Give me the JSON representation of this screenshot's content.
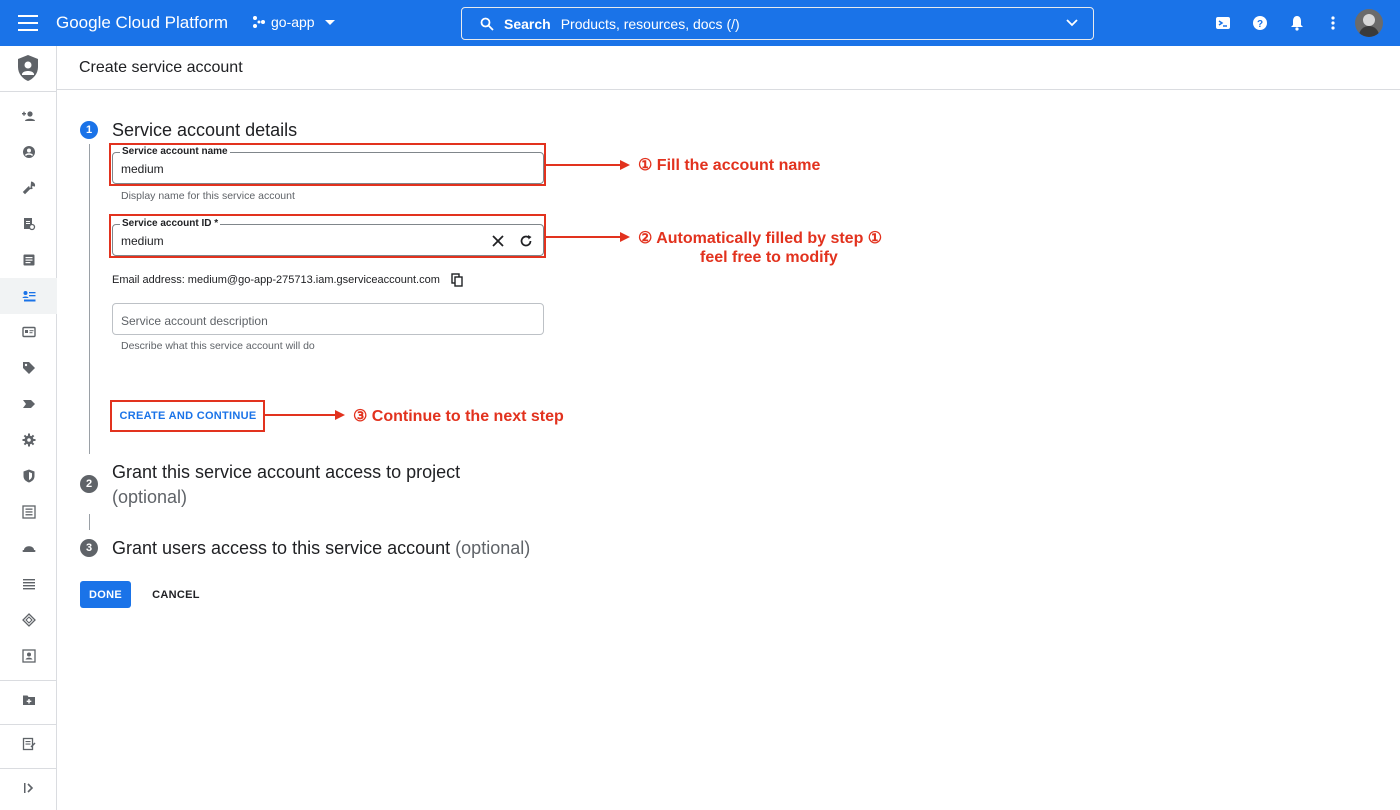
{
  "topbar": {
    "app_title": "Google Cloud Platform",
    "project_name": "go-app",
    "search_label": "Search",
    "search_hint": "Products, resources, docs (/)"
  },
  "header": {
    "title": "Create service account"
  },
  "steps": [
    {
      "number": "1",
      "title": "Service account details",
      "optional": ""
    },
    {
      "number": "2",
      "title": "Grant this service account access to project",
      "optional": "(optional)"
    },
    {
      "number": "3",
      "title": "Grant users access to this service account",
      "optional": "(optional)"
    }
  ],
  "form": {
    "name_label": "Service account name",
    "name_value": "medium",
    "name_hint": "Display name for this service account",
    "id_label": "Service account ID *",
    "id_value": "medium",
    "email_text": "Email address: medium@go-app-275713.iam.gserviceaccount.com",
    "description_placeholder": "Service account description",
    "description_hint": "Describe what this service account will do",
    "create_button": "CREATE AND CONTINUE"
  },
  "actions": {
    "done": "DONE",
    "cancel": "CANCEL"
  },
  "annotations": {
    "step1": "① Fill the account name",
    "step2_line1": "② Automatically filled by step ①",
    "step2_line2": "feel free to modify",
    "step3": "③ Continue to the next step",
    "color": "#e2321e"
  },
  "colors": {
    "brand_blue": "#1a73e8",
    "annotation_red": "#e2321e"
  },
  "sidebar_icons": [
    "iam-shield-logo",
    "add-person-icon",
    "account-circle-icon",
    "wrench-icon",
    "policy-doc-icon",
    "audit-log-icon",
    "service-accounts-icon",
    "workload-identity-icon",
    "tag-icon",
    "label-icon",
    "settings-icon",
    "shield-icon",
    "identity-aware-icon",
    "hat-icon",
    "list-icon",
    "diamond-icon",
    "roles-icon",
    "folder-plus-icon",
    "notes-icon",
    "expand-sidebar-icon"
  ]
}
